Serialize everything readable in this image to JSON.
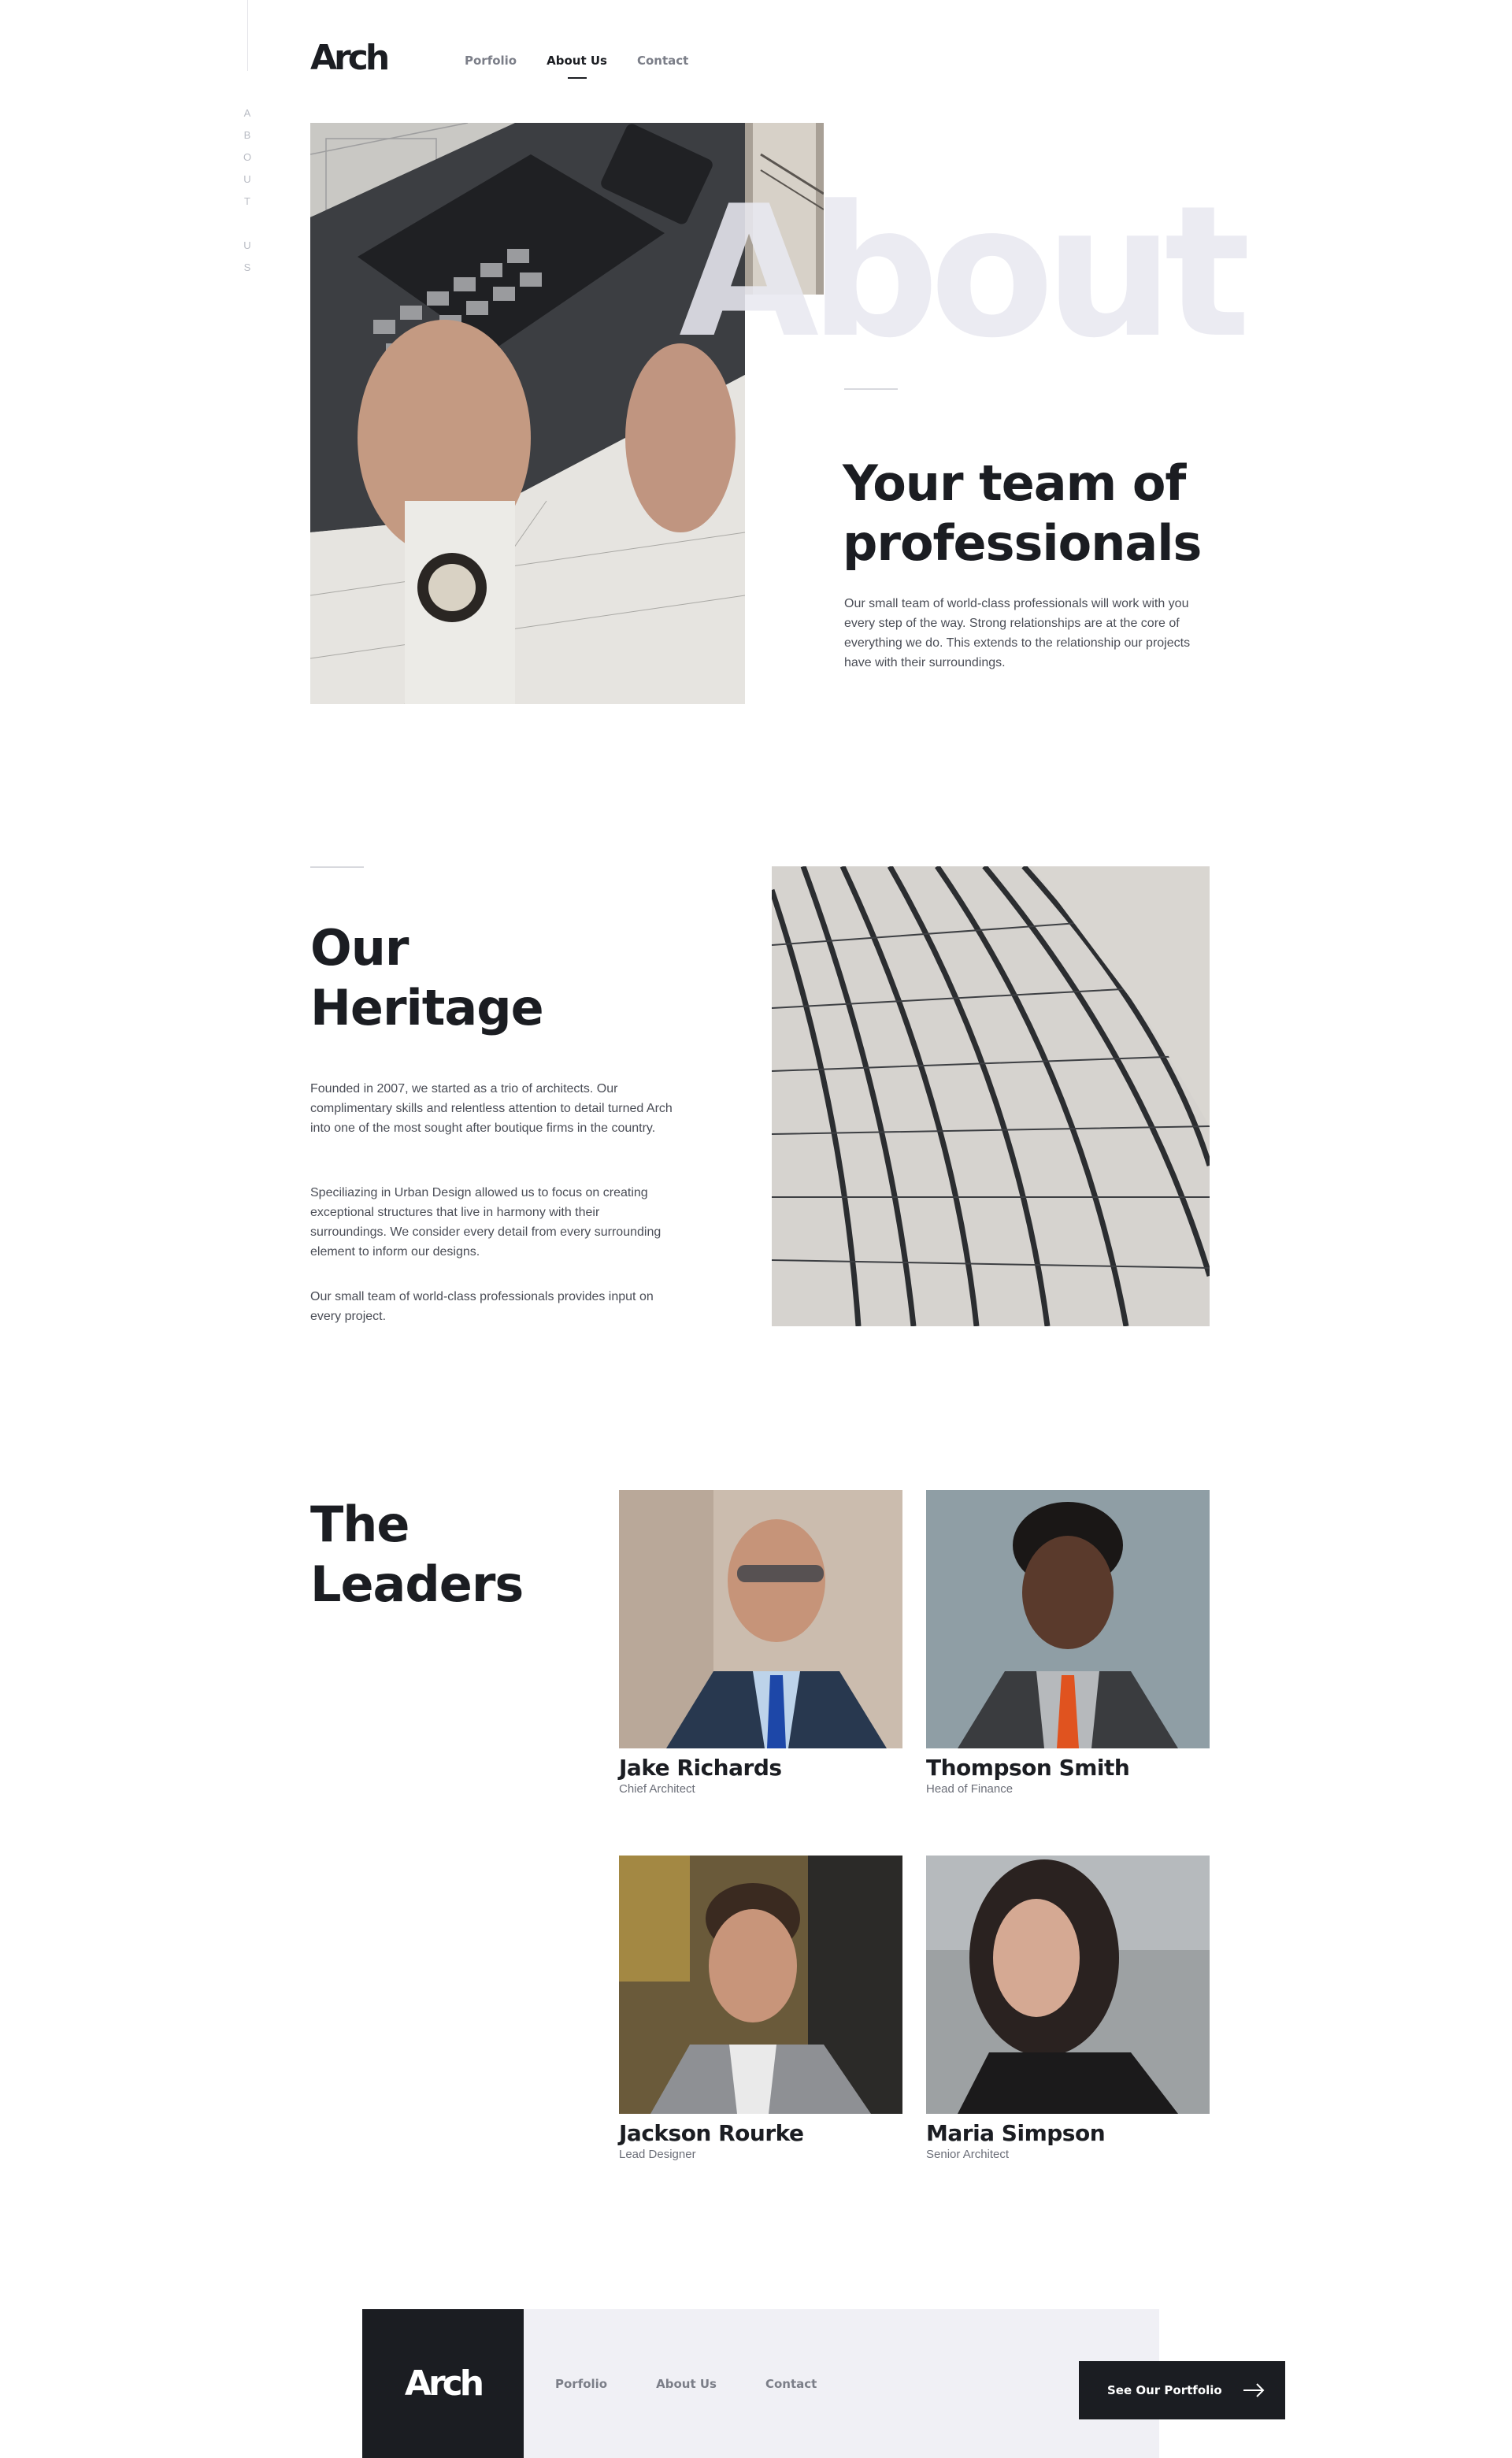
{
  "brand": {
    "logo": "Arch"
  },
  "side_label": [
    "A",
    "B",
    "O",
    "U",
    "T",
    "",
    "U",
    "S"
  ],
  "nav": {
    "items": [
      {
        "label": "Porfolio",
        "active": false
      },
      {
        "label": "About Us",
        "active": true
      },
      {
        "label": "Contact",
        "active": false
      }
    ]
  },
  "hero": {
    "watermark": "About",
    "title_line1": "Your team of",
    "title_line2": "professionals",
    "text": "Our small team of world-class professionals will work with you every step of the way. Strong relationships are at the core of everything we do. This extends to the relationship our projects have with their surroundings."
  },
  "heritage": {
    "title_line1": "Our",
    "title_line2": "Heritage",
    "p1": "Founded in 2007, we started as a trio of architects. Our complimentary skills and relentless attention to detail turned Arch into one of the most sought after boutique firms in the country.",
    "p2": "Speciliazing in Urban Design allowed us to focus on creating exceptional structures that live in harmony with their surroundings. We consider every detail from every surrounding element to inform our designs.",
    "p3": "Our small team of world-class professionals provides input on every project."
  },
  "leaders": {
    "title_line1": "The",
    "title_line2": "Leaders",
    "people": [
      {
        "name": "Jake Richards",
        "role": "Chief Architect"
      },
      {
        "name": "Thompson Smith",
        "role": "Head of Finance"
      },
      {
        "name": "Jackson Rourke",
        "role": "Lead Designer"
      },
      {
        "name": "Maria Simpson",
        "role": "Senior Architect"
      }
    ]
  },
  "footer": {
    "logo": "Arch",
    "nav": [
      "Porfolio",
      "About Us",
      "Contact"
    ],
    "cta_label": "See Our Portfolio"
  },
  "icons": {
    "cta_arrow": "arrow-right-icon"
  },
  "colors": {
    "dark": "#1b1d22",
    "muted": "#7b7e88",
    "footer_bg": "#f0f0f5",
    "watermark": "#e8e8f0"
  }
}
